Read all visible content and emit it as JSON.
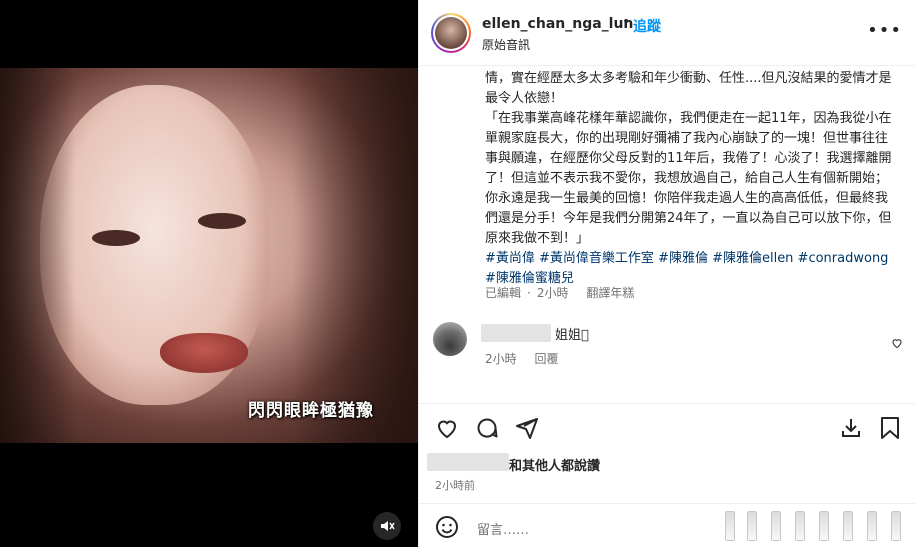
{
  "media": {
    "caption": "閃閃眼眸極猶豫"
  },
  "header": {
    "username": "ellen_chan_nga_lun",
    "separator": "•",
    "follow_label": "追蹤",
    "subtitle": "原始音訊",
    "more_label": "•••"
  },
  "post": {
    "line1": "情，實在經歷太多太多考驗和年少衝動、任性....但凡沒結果的愛情才是最令人依戀！",
    "line2": "「在我事業高峰花樣年華認識你，我們便走在一起11年，因為我從小在單親家庭長大，你的出現剛好彌補了我內心崩缺了的一塊！但世事往往事與願違，在經歷你父母反對的11年后，我倦了！心淡了！我選擇離開了！但這並不表示我不愛你，我想放過自己，給自己人生有個新開始；你永遠是我一生最美的回憶！你陪伴我走過人生的高高低低，但最終我們還是分手！今年是我們分開第24年了，一直以為自己可以放下你，但原來我做不到！」",
    "tags": "#黃尚偉 #黃尚偉音樂工作室 #陳雅倫 #陳雅倫ellen #conradwong #陳雅倫蜜糖兒",
    "edited": "已編輯",
    "dot": "·",
    "post_time": "2小時",
    "see_translation": "翻譯年糕"
  },
  "comment": {
    "text": "姐姐𠁪",
    "time": "2小時",
    "reply_label": "回覆"
  },
  "likes": {
    "text": "和其他人都說讚"
  },
  "timestamp": "2小時前",
  "add_comment": {
    "placeholder": "留言……"
  },
  "icons": {
    "heart": "heart-icon",
    "comment": "comment-icon",
    "share": "share-icon",
    "save": "bookmark-icon",
    "smile": "smile-icon",
    "mute": "speaker-muted-icon"
  },
  "colors": {
    "link_blue": "#0095f6",
    "tag_blue": "#00376b",
    "muted_gray": "#737373"
  }
}
